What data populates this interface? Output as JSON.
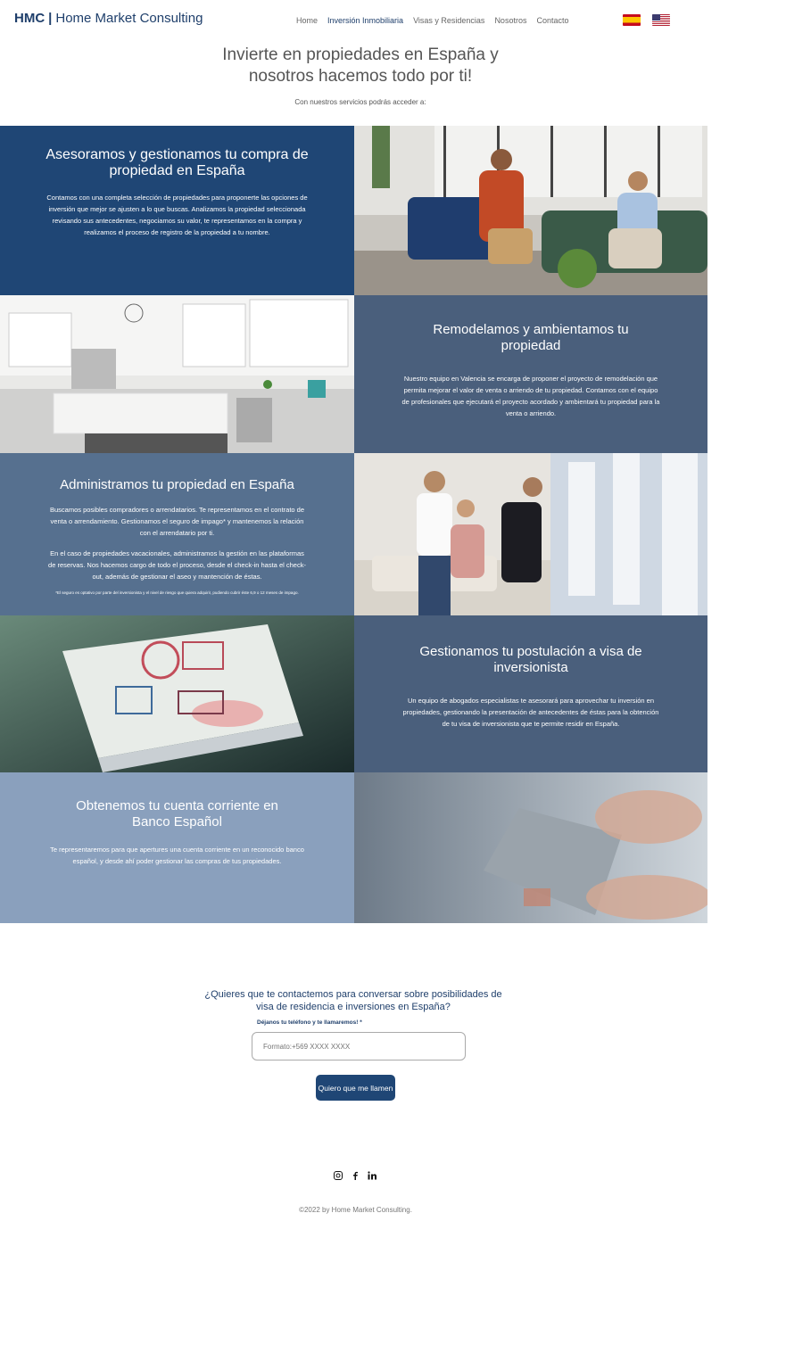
{
  "header": {
    "logo_abbr": "HMC",
    "logo_sep": "|",
    "logo_name": "Home Market Consulting",
    "nav": [
      "Home",
      "Inversión Inmobiliaria",
      "Visas y Residencias",
      "Nosotros",
      "Contacto"
    ]
  },
  "hero": {
    "title": "Invierte en propiedades en España y nosotros hacemos todo por ti!",
    "subtitle": "Con nuestros servicios podrás acceder a:"
  },
  "services": {
    "s1": {
      "title": "Asesoramos y gestionamos tu compra de propiedad en España",
      "text": "Contamos con una completa selección de propiedades para proponerte las opciones de inversión que mejor se ajusten a lo que buscas. Analizamos la propiedad seleccionada revisando sus antecedentes, negociamos su valor, te representamos en la compra y realizamos el proceso de registro de la propiedad a tu nombre."
    },
    "s2": {
      "title": "Remodelamos y ambientamos tu propiedad",
      "text": "Nuestro equipo en Valencia se encarga de proponer el proyecto de remodelación que permita mejorar el valor de venta o arriendo de tu propiedad. Contamos con el equipo de profesionales que ejecutará el proyecto acordado y ambientará tu propiedad para la venta o arriendo."
    },
    "s3": {
      "title": "Administramos tu propiedad en España",
      "text1": "Buscamos posibles compradores o arrendatarios. Te representamos en el contrato de venta o arrendamiento. Gestionamos el seguro de impago* y mantenemos la relación con el arrendatario por ti.",
      "text2": "En el caso de propiedades vacacionales, administramos la gestión en las plataformas de reservas. Nos hacemos cargo de todo el proceso, desde el check-in hasta el check-out, además de gestionar el aseo y mantención de éstas.",
      "note": "*El seguro es optativo por parte del inversionista y el nivel de riesgo que quiera adquirir, pudiendo cubrir éste 6,9 o 12 meses de impago."
    },
    "s4": {
      "title": "Gestionamos tu postulación a visa de inversionista",
      "text": "Un equipo de abogados especialistas te asesorará para aprovechar tu inversión en propiedades, gestionando la presentación de antecedentes de éstas para la obtención de tu visa de inversionista que te permite residir en España."
    },
    "s5": {
      "title": "Obtenemos tu cuenta corriente en Banco Español",
      "text": "Te representaremos para que apertures una cuenta corriente en un reconocido banco español, y desde ahí poder gestionar las compras de tus propiedades."
    }
  },
  "contact": {
    "question": "¿Quieres que te contactemos para conversar sobre posibilidades de visa de residencia e inversiones en España?",
    "label": "Déjanos tu teléfono y te llamaremos! *",
    "placeholder": "Formato:+569 XXXX XXXX",
    "button": "Quiero que me llamen"
  },
  "social": [
    "instagram-icon",
    "facebook-icon",
    "linkedin-icon"
  ],
  "footer": "©2022 by Home Market Consulting.",
  "colors": {
    "navy": "#1f4675",
    "slate": "#4a5f7c",
    "slate2": "#56708f",
    "light": "#8aa0bd"
  }
}
